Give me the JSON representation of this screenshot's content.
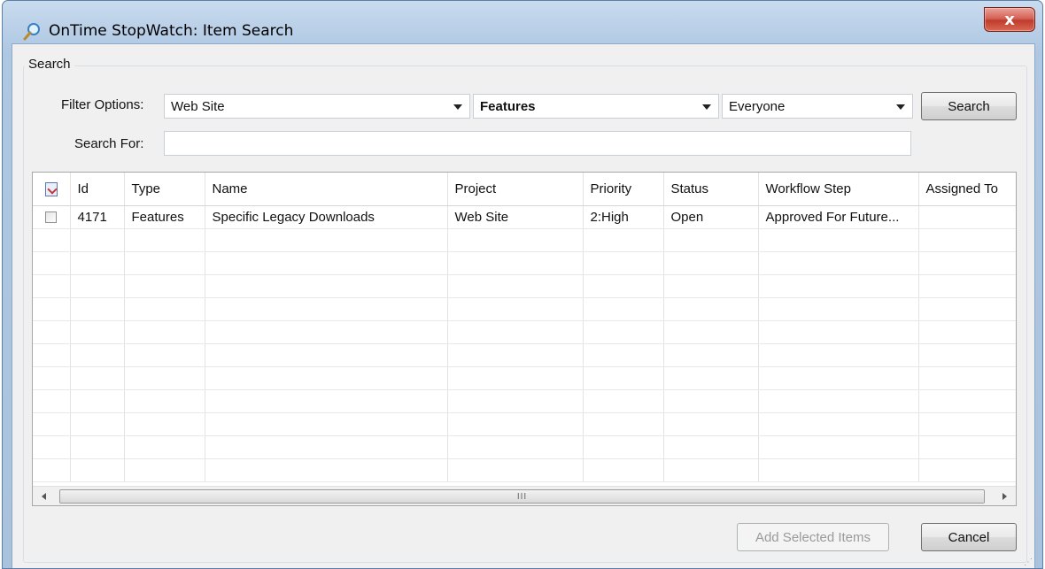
{
  "window": {
    "title": "OnTime StopWatch: Item Search",
    "close_glyph": "x",
    "title_icon": "magnifier-icon"
  },
  "search_group": {
    "legend": "Search",
    "filter_label": "Filter Options:",
    "search_for_label": "Search For:",
    "project_select": "Web Site",
    "type_select": "Features",
    "user_select": "Everyone",
    "search_for_value": "",
    "search_button": "Search"
  },
  "grid": {
    "columns": [
      "Id",
      "Type",
      "Name",
      "Project",
      "Priority",
      "Status",
      "Workflow Step",
      "Assigned To"
    ],
    "rows": [
      {
        "checked": false,
        "cells": [
          "4171",
          "Features",
          "Specific Legacy Downloads",
          "Web Site",
          "2:High",
          "Open",
          "Approved For Future...",
          ""
        ]
      }
    ],
    "scroll_thumb_text": "III"
  },
  "footer": {
    "add_button": "Add Selected Items",
    "cancel_button": "Cancel"
  },
  "colors": {
    "window_frame": "#b6cde6",
    "close_button": "#c94636",
    "client_bg": "#f0f0f0"
  }
}
